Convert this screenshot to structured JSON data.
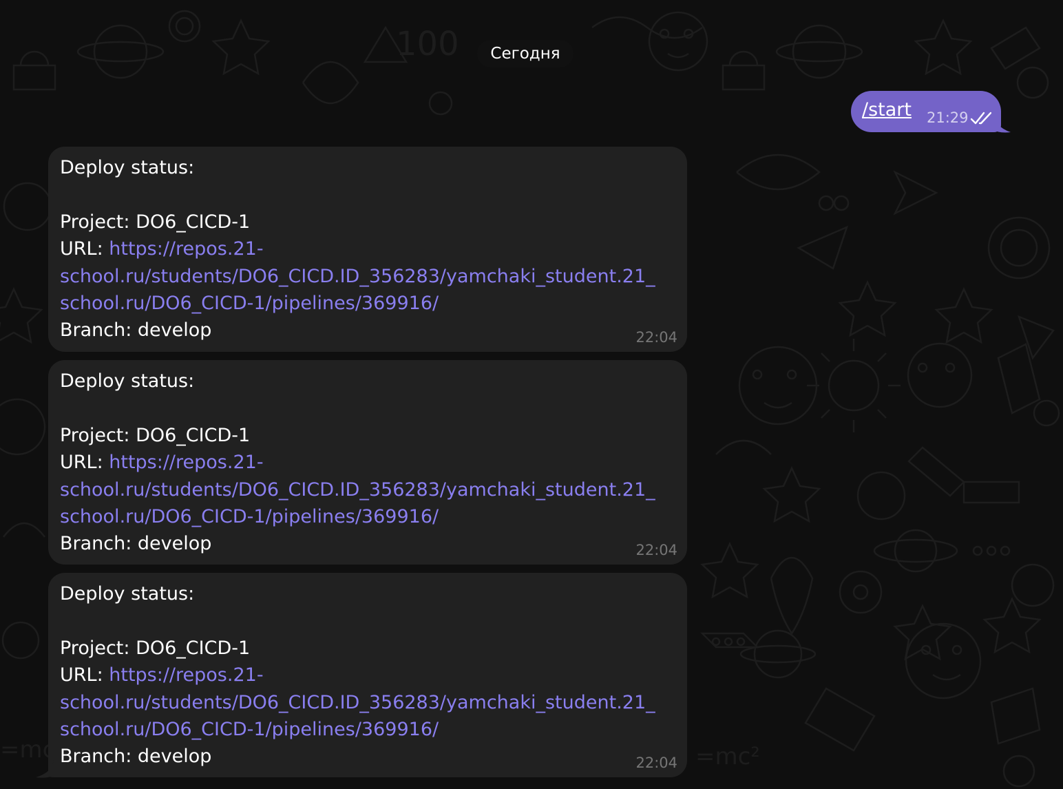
{
  "date_separator": "Сегодня",
  "outgoing": {
    "text": "/start",
    "time": "21:29",
    "status_icon": "double-check-icon"
  },
  "messages": [
    {
      "title": "Deploy status:",
      "project_label": "Project: ",
      "project_value": "DO6_CICD-1",
      "url_label": "URL: ",
      "url_line1": "https://repos.21-",
      "url_line2": "school.ru/students/DO6_CICD.ID_356283/yamchaki_student.21_",
      "url_line3": "school.ru/DO6_CICD-1/pipelines/369916/",
      "branch_label": "Branch: ",
      "branch_value": "develop",
      "time": "22:04"
    },
    {
      "title": "Deploy status:",
      "project_label": "Project: ",
      "project_value": "DO6_CICD-1",
      "url_label": "URL: ",
      "url_line1": "https://repos.21-",
      "url_line2": "school.ru/students/DO6_CICD.ID_356283/yamchaki_student.21_",
      "url_line3": "school.ru/DO6_CICD-1/pipelines/369916/",
      "branch_label": "Branch: ",
      "branch_value": "develop",
      "time": "22:04"
    },
    {
      "title": "Deploy status:",
      "project_label": "Project: ",
      "project_value": "DO6_CICD-1",
      "url_label": "URL: ",
      "url_line1": "https://repos.21-",
      "url_line2": "school.ru/students/DO6_CICD.ID_356283/yamchaki_student.21_",
      "url_line3": "school.ru/DO6_CICD-1/pipelines/369916/",
      "branch_label": "Branch: ",
      "branch_value": "develop",
      "time": "22:04"
    }
  ],
  "colors": {
    "background": "#0f0f0f",
    "outgoing_bubble": "#7463c8",
    "incoming_bubble": "#212121",
    "link": "#8a7ff0"
  }
}
